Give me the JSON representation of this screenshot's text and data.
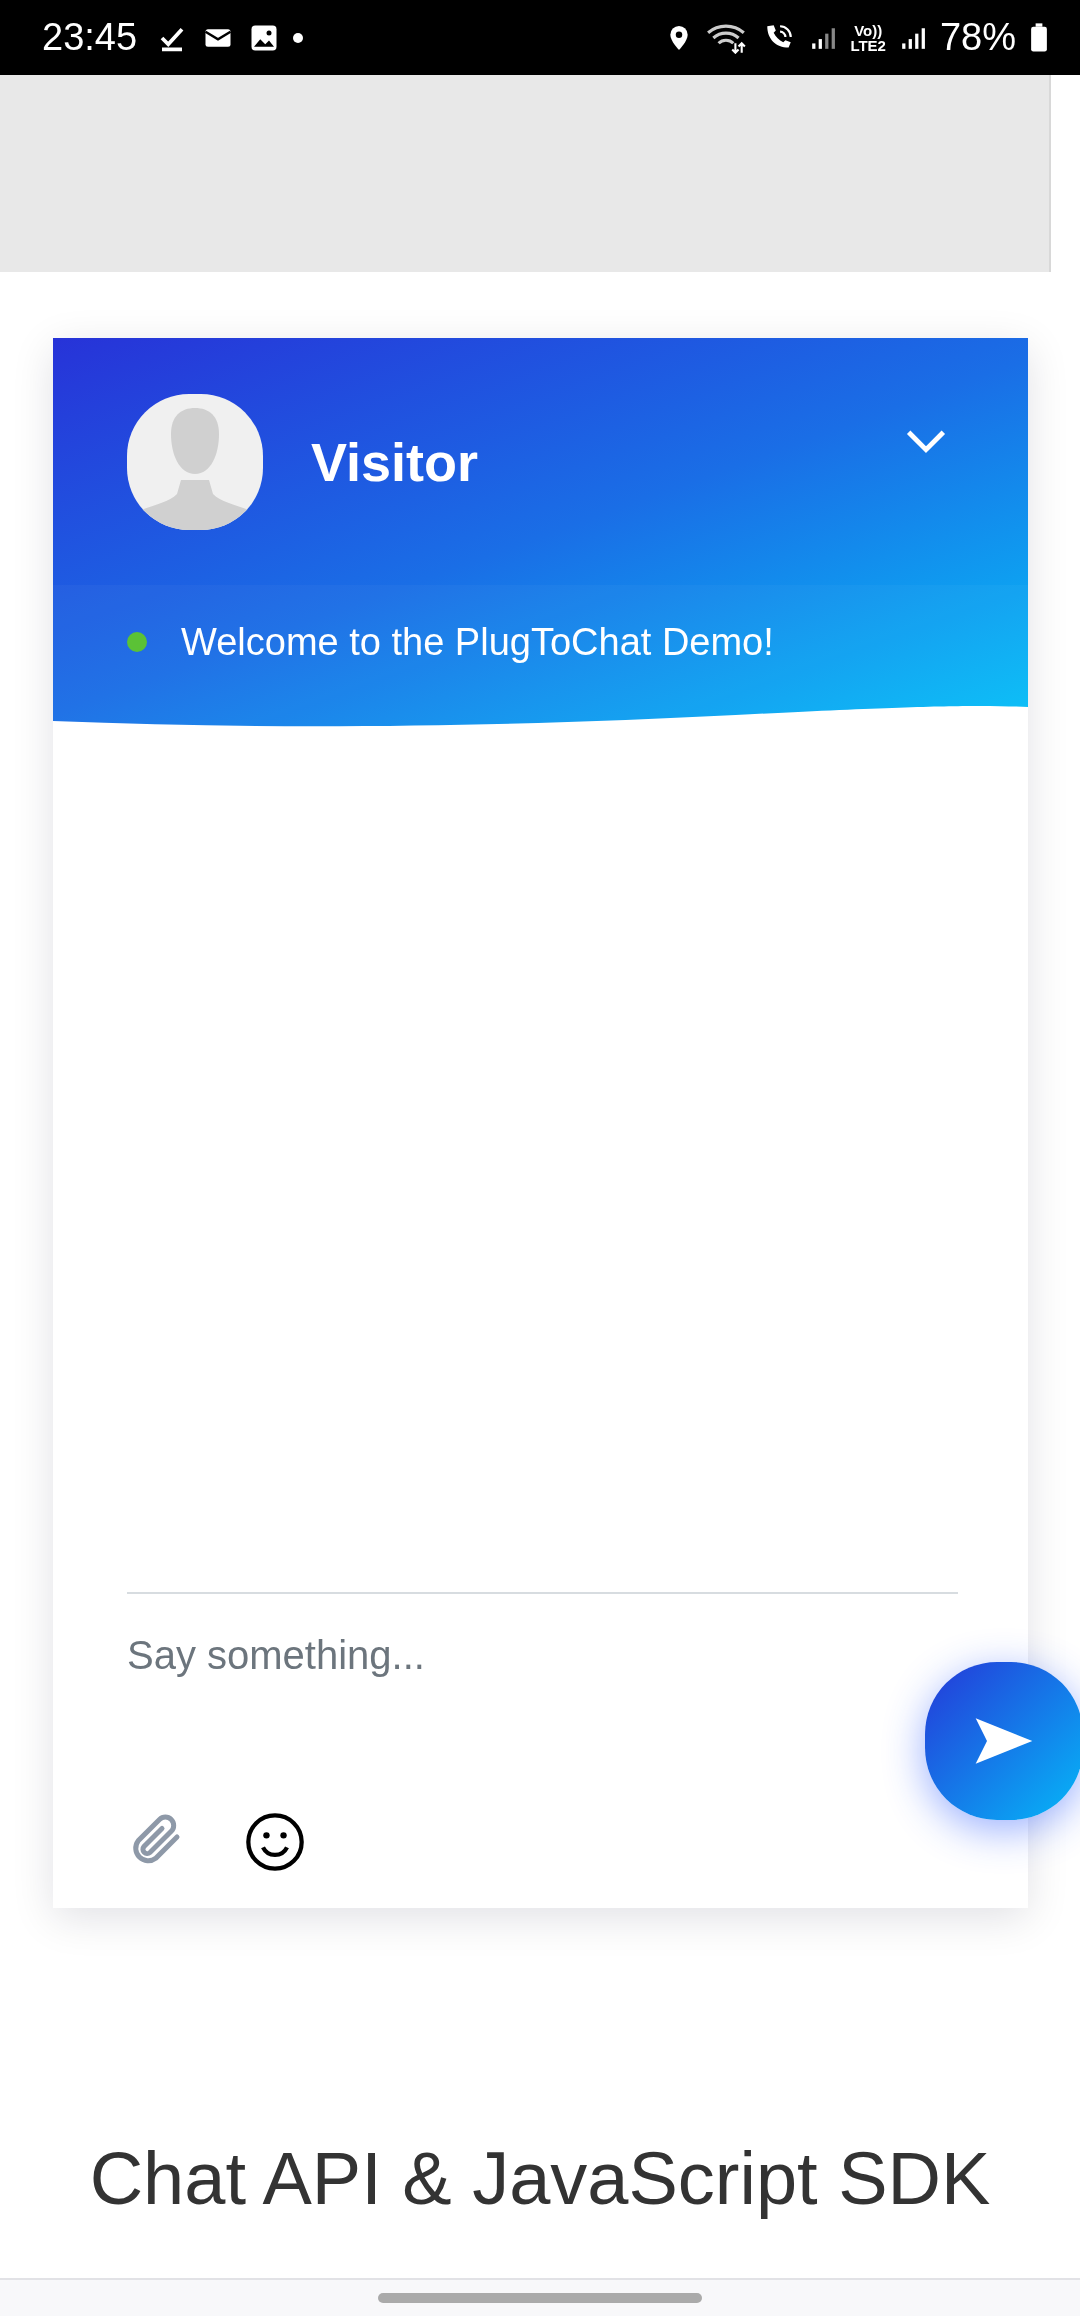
{
  "status_bar": {
    "time": "23:45",
    "volte_top": "Vo))",
    "volte_bottom": "LTE2",
    "battery": "78%"
  },
  "chat": {
    "name": "Visitor",
    "status": {
      "text": "Welcome to the PlugToChat Demo!",
      "online": true
    },
    "composer": {
      "placeholder": "Say something..."
    }
  },
  "heading": {
    "line_1": "Chat API & JavaScript SDK"
  }
}
